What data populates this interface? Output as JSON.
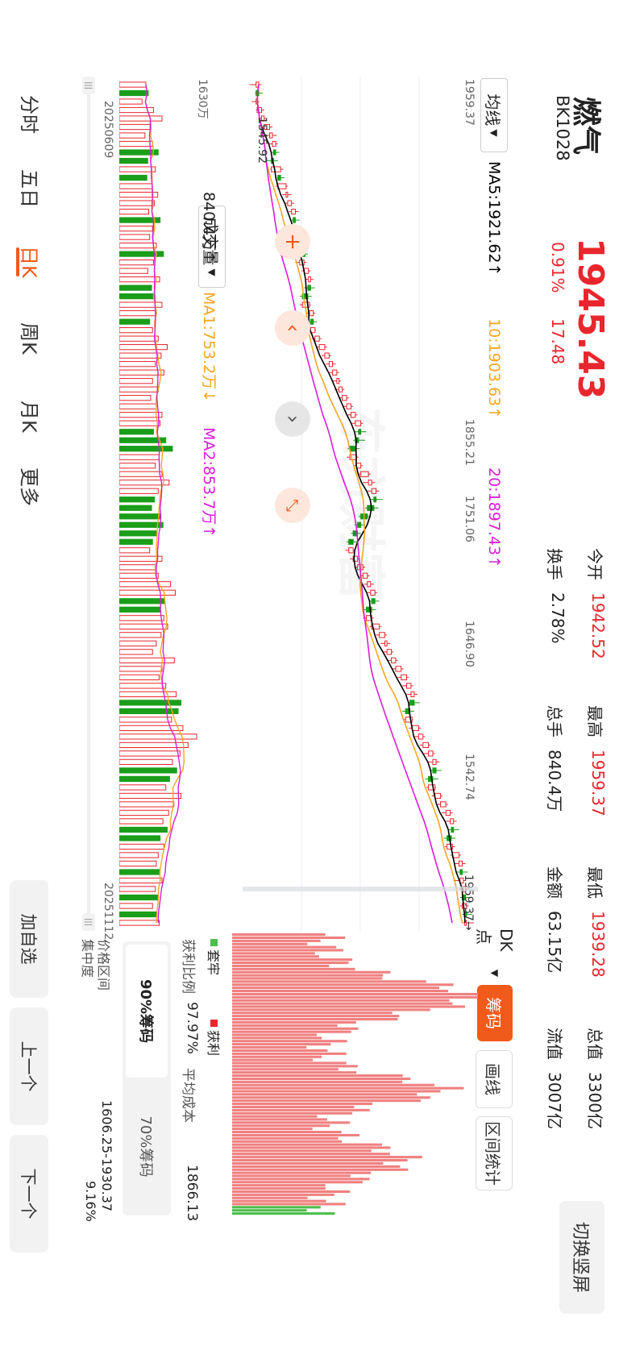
{
  "header": {
    "name": "燃气",
    "code": "BK1028",
    "price": "1945.43",
    "change_pct": "0.91%",
    "change_abs": "17.48",
    "switch_label": "切换竖屏",
    "stats": [
      {
        "label": "今开",
        "value": "1942.52",
        "color": "#e8262d"
      },
      {
        "label": "换手",
        "value": "2.78%",
        "color": "#222"
      },
      {
        "label": "最高",
        "value": "1959.37",
        "color": "#e8262d"
      },
      {
        "label": "总手",
        "value": "840.4万",
        "color": "#222"
      },
      {
        "label": "最低",
        "value": "1939.28",
        "color": "#e8262d"
      },
      {
        "label": "金额",
        "value": "63.15亿",
        "color": "#222"
      },
      {
        "label": "总值",
        "value": "3300亿",
        "color": "#222"
      },
      {
        "label": "流值",
        "value": "3007亿",
        "color": "#222"
      }
    ]
  },
  "indicator": {
    "selector": "均线",
    "ma5": "MA5:1921.62↑",
    "ma10": "10:1903.63↑",
    "ma20": "20:1897.43↑"
  },
  "volume_indicator": {
    "selector": "成交量",
    "value": "840.4万↑",
    "ma1": "MA1:753.2万↓",
    "ma2": "MA2:853.7万↑"
  },
  "axis": {
    "price_ticks": [
      "1959.37",
      "1855.21",
      "1751.06",
      "1646.90",
      "1542.74"
    ],
    "low_marker": "1542.74",
    "low_marker_badge": "1545.92",
    "high_marker": "1959.37",
    "volume_tick": "1630万",
    "start_date": "20250609",
    "end_date": "20251112"
  },
  "chip_panel": {
    "dk_label": "DK点",
    "tabs": [
      "筹码",
      "画线",
      "区间统计"
    ],
    "active_tab": "筹码",
    "legend_trapped": "套牢",
    "legend_profit": "获利",
    "profit_ratio_label": "获利比例",
    "profit_ratio_value": "97.97%",
    "avg_cost_label": "平均成本",
    "avg_cost_value": "1866.13",
    "chip90": "90%筹码",
    "chip70": "70%筹码",
    "price_range_label": "价格区间",
    "price_range_value": "1606.25-1930.37",
    "concentration_label": "集中度",
    "concentration_value": "9.16%"
  },
  "period_tabs": [
    "分时",
    "五日",
    "日K",
    "周K",
    "月K",
    "更多"
  ],
  "active_period": "日K",
  "side_buttons": [
    "加自选",
    "上一个",
    "下一个"
  ],
  "watermark": "东方财富",
  "colors": {
    "up": "#e8262d",
    "down": "#1a9e1a",
    "ma5": "#000000",
    "ma10": "#f5a623",
    "ma20": "#d81ed8",
    "accent": "#f05a1a"
  },
  "chart_data": {
    "type": "candlestick",
    "ylim": [
      1542.74,
      1959.37
    ],
    "x_range": [
      "20250609",
      "20251112"
    ],
    "ohlc": [
      [
        1560,
        1570,
        1548,
        1565
      ],
      [
        1565,
        1572,
        1558,
        1560
      ],
      [
        1560,
        1566,
        1552,
        1562
      ],
      [
        1562,
        1575,
        1560,
        1570
      ],
      [
        1570,
        1580,
        1564,
        1575
      ],
      [
        1575,
        1590,
        1570,
        1585
      ],
      [
        1585,
        1598,
        1578,
        1590
      ],
      [
        1590,
        1600,
        1584,
        1596
      ],
      [
        1596,
        1603,
        1588,
        1592
      ],
      [
        1592,
        1600,
        1580,
        1588
      ],
      [
        1588,
        1610,
        1586,
        1605
      ],
      [
        1605,
        1612,
        1598,
        1600
      ],
      [
        1600,
        1618,
        1596,
        1615
      ],
      [
        1615,
        1625,
        1608,
        1618
      ],
      [
        1618,
        1630,
        1612,
        1625
      ],
      [
        1625,
        1638,
        1620,
        1632
      ],
      [
        1632,
        1640,
        1622,
        1628
      ],
      [
        1628,
        1645,
        1625,
        1640
      ],
      [
        1640,
        1650,
        1634,
        1646
      ],
      [
        1646,
        1656,
        1640,
        1650
      ],
      [
        1650,
        1655,
        1636,
        1640
      ],
      [
        1640,
        1652,
        1632,
        1648
      ],
      [
        1648,
        1660,
        1644,
        1656
      ],
      [
        1656,
        1665,
        1650,
        1660
      ],
      [
        1660,
        1668,
        1648,
        1655
      ],
      [
        1655,
        1662,
        1640,
        1645
      ],
      [
        1645,
        1660,
        1640,
        1658
      ],
      [
        1658,
        1668,
        1652,
        1665
      ],
      [
        1665,
        1672,
        1656,
        1660
      ],
      [
        1660,
        1670,
        1652,
        1668
      ],
      [
        1668,
        1680,
        1662,
        1676
      ],
      [
        1676,
        1690,
        1670,
        1686
      ],
      [
        1686,
        1698,
        1680,
        1694
      ],
      [
        1694,
        1706,
        1688,
        1700
      ],
      [
        1700,
        1712,
        1694,
        1708
      ],
      [
        1708,
        1716,
        1700,
        1712
      ],
      [
        1712,
        1722,
        1704,
        1718
      ],
      [
        1718,
        1730,
        1712,
        1726
      ],
      [
        1726,
        1738,
        1720,
        1734
      ],
      [
        1734,
        1746,
        1728,
        1742
      ],
      [
        1742,
        1756,
        1736,
        1752
      ],
      [
        1752,
        1762,
        1742,
        1748
      ],
      [
        1748,
        1760,
        1738,
        1742
      ],
      [
        1742,
        1750,
        1728,
        1732
      ],
      [
        1732,
        1748,
        1726,
        1744
      ],
      [
        1744,
        1756,
        1738,
        1752
      ],
      [
        1752,
        1770,
        1748,
        1766
      ],
      [
        1766,
        1778,
        1756,
        1772
      ],
      [
        1772,
        1786,
        1764,
        1780
      ],
      [
        1780,
        1792,
        1770,
        1776
      ],
      [
        1776,
        1784,
        1760,
        1764
      ],
      [
        1764,
        1770,
        1748,
        1752
      ],
      [
        1752,
        1760,
        1740,
        1746
      ],
      [
        1746,
        1752,
        1734,
        1738
      ],
      [
        1738,
        1746,
        1726,
        1730
      ],
      [
        1730,
        1742,
        1724,
        1738
      ],
      [
        1738,
        1750,
        1732,
        1746
      ],
      [
        1746,
        1760,
        1740,
        1756
      ],
      [
        1756,
        1768,
        1750,
        1764
      ],
      [
        1764,
        1776,
        1758,
        1770
      ],
      [
        1770,
        1782,
        1764,
        1778
      ],
      [
        1778,
        1786,
        1768,
        1772
      ],
      [
        1772,
        1780,
        1758,
        1762
      ],
      [
        1762,
        1776,
        1756,
        1772
      ],
      [
        1772,
        1790,
        1768,
        1786
      ],
      [
        1786,
        1800,
        1780,
        1796
      ],
      [
        1796,
        1806,
        1788,
        1800
      ],
      [
        1800,
        1812,
        1794,
        1808
      ],
      [
        1808,
        1820,
        1800,
        1816
      ],
      [
        1816,
        1830,
        1810,
        1826
      ],
      [
        1826,
        1840,
        1818,
        1836
      ],
      [
        1836,
        1848,
        1828,
        1844
      ],
      [
        1844,
        1856,
        1836,
        1850
      ],
      [
        1850,
        1860,
        1838,
        1842
      ],
      [
        1842,
        1850,
        1828,
        1834
      ],
      [
        1834,
        1848,
        1830,
        1846
      ],
      [
        1846,
        1862,
        1840,
        1858
      ],
      [
        1858,
        1870,
        1850,
        1866
      ],
      [
        1866,
        1880,
        1860,
        1876
      ],
      [
        1876,
        1888,
        1868,
        1884
      ],
      [
        1884,
        1896,
        1876,
        1890
      ],
      [
        1890,
        1900,
        1878,
        1884
      ],
      [
        1884,
        1894,
        1870,
        1876
      ],
      [
        1876,
        1890,
        1872,
        1888
      ],
      [
        1888,
        1902,
        1882,
        1898
      ],
      [
        1898,
        1912,
        1890,
        1908
      ],
      [
        1908,
        1920,
        1900,
        1916
      ],
      [
        1916,
        1928,
        1908,
        1922
      ],
      [
        1922,
        1932,
        1912,
        1918
      ],
      [
        1918,
        1926,
        1904,
        1910
      ],
      [
        1910,
        1924,
        1906,
        1920
      ],
      [
        1920,
        1936,
        1916,
        1932
      ],
      [
        1932,
        1944,
        1924,
        1938
      ],
      [
        1938,
        1948,
        1928,
        1934
      ],
      [
        1934,
        1944,
        1922,
        1940
      ],
      [
        1940,
        1950,
        1932,
        1944
      ],
      [
        1944,
        1952,
        1934,
        1938
      ],
      [
        1938,
        1950,
        1934,
        1946
      ],
      [
        1946,
        1956,
        1938,
        1942
      ],
      [
        1942.52,
        1959.37,
        1939.28,
        1945.43
      ]
    ],
    "ma5_last": 1921.62,
    "ma10_last": 1903.63,
    "ma20_last": 1897.43,
    "volume_unit": "万",
    "volume_max": 1630,
    "volumes": [
      560,
      610,
      480,
      720,
      900,
      650,
      540,
      700,
      820,
      600,
      760,
      580,
      690,
      810,
      740,
      620,
      860,
      700,
      640,
      780,
      930,
      720,
      600,
      850,
      680,
      740,
      900,
      760,
      640,
      700,
      820,
      1010,
      880,
      760,
      940,
      700,
      820,
      660,
      780,
      900,
      860,
      720,
      980,
      1120,
      840,
      760,
      900,
      1050,
      820,
      740,
      680,
      860,
      920,
      780,
      700,
      640,
      900,
      760,
      820,
      1080,
      1180,
      960,
      860,
      940,
      1020,
      880,
      780,
      700,
      1160,
      900,
      840,
      980,
      1200,
      1300,
      1240,
      1100,
      1340,
      1630,
      1450,
      1280,
      1120,
      1210,
      1060,
      980,
      1300,
      1150,
      1040,
      920,
      1010,
      860,
      940,
      820,
      780,
      860,
      900,
      760,
      820,
      700,
      780,
      840.4
    ]
  }
}
